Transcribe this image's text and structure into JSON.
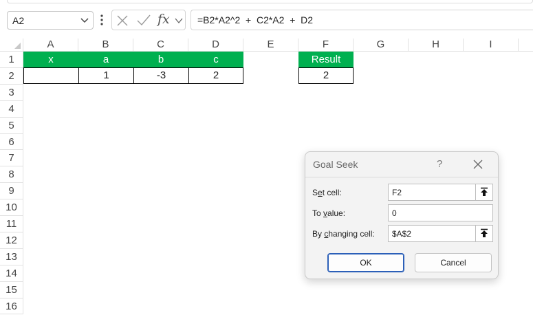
{
  "name_box": {
    "value": "A2"
  },
  "formula_bar": {
    "fx_label": "fx",
    "formula": "=B2*A2^2  +  C2*A2  +  D2"
  },
  "grid": {
    "columns": [
      "A",
      "B",
      "C",
      "D",
      "E",
      "F",
      "G",
      "H",
      "I"
    ],
    "rows": [
      "1",
      "2",
      "3",
      "4",
      "5",
      "6",
      "7",
      "8",
      "9",
      "10",
      "11",
      "12",
      "13",
      "14",
      "15",
      "16"
    ],
    "table": {
      "headers": [
        "x",
        "a",
        "b",
        "c"
      ],
      "values": [
        "",
        "1",
        "-3",
        "2"
      ]
    },
    "result": {
      "header": "Result",
      "value": "2"
    },
    "header_fill": "#00b050"
  },
  "goal_seek": {
    "title": "Goal Seek",
    "help": "?",
    "set_cell": {
      "label_pre": "S",
      "label_u": "e",
      "label_post": "t cell:",
      "value": "F2"
    },
    "to_value": {
      "label_pre": "To ",
      "label_u": "v",
      "label_post": "alue:",
      "value": "0"
    },
    "changing_cell": {
      "label_pre": "By ",
      "label_u": "c",
      "label_post": "hanging cell:",
      "value": "$A$2"
    },
    "ok_label": "OK",
    "cancel_label": "Cancel"
  }
}
